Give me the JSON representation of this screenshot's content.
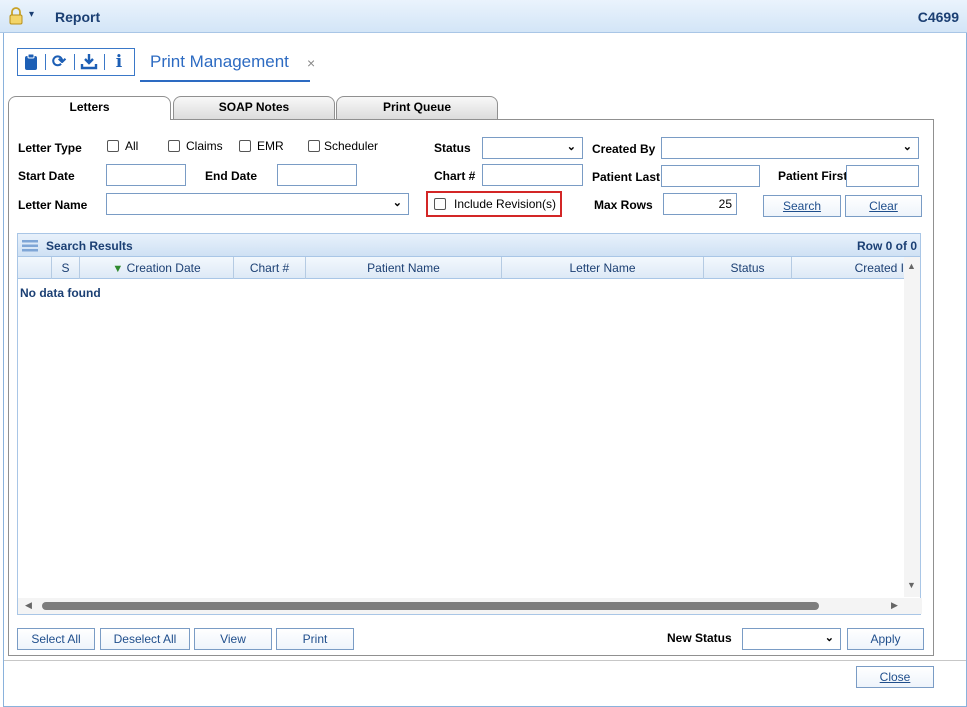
{
  "window": {
    "title": "Report",
    "code": "C4699"
  },
  "toolbar": {
    "icons": [
      "clipboard-icon",
      "refresh-icon",
      "download-icon",
      "info-icon"
    ]
  },
  "page_tab": {
    "label": "Print Management",
    "close": "×"
  },
  "tabs": [
    {
      "label": "Letters",
      "active": true
    },
    {
      "label": "SOAP Notes",
      "active": false
    },
    {
      "label": "Print Queue",
      "active": false
    }
  ],
  "filters": {
    "letter_type_label": "Letter Type",
    "type_options": [
      "All",
      "Claims",
      "EMR",
      "Scheduler"
    ],
    "status_label": "Status",
    "status_value": "",
    "created_by_label": "Created By",
    "created_by_value": "",
    "start_date_label": "Start Date",
    "start_date_value": "",
    "end_date_label": "End Date",
    "end_date_value": "",
    "chart_label": "Chart #",
    "chart_value": "",
    "patient_last_label": "Patient Last",
    "patient_last_value": "",
    "patient_first_label": "Patient First",
    "patient_first_value": "",
    "letter_name_label": "Letter Name",
    "letter_name_value": "",
    "include_revisions_label": "Include Revision(s)",
    "max_rows_label": "Max Rows",
    "max_rows_value": "25",
    "search_button": "Search",
    "clear_button": "Clear"
  },
  "results": {
    "title": "Search Results",
    "row_count": "Row 0 of 0",
    "columns": [
      "S",
      "Creation Date",
      "Chart #",
      "Patient Name",
      "Letter Name",
      "Status",
      "Created I"
    ],
    "sort_indicator": "▼",
    "empty_message": "No data found"
  },
  "footer": {
    "select_all": "Select All",
    "deselect_all": "Deselect All",
    "view": "View",
    "print": "Print",
    "new_status_label": "New Status",
    "new_status_value": "",
    "apply": "Apply",
    "close": "Close"
  },
  "colors": {
    "accent": "#2d6bc2",
    "header_text": "#1b3f73",
    "highlight": "#d32626"
  }
}
